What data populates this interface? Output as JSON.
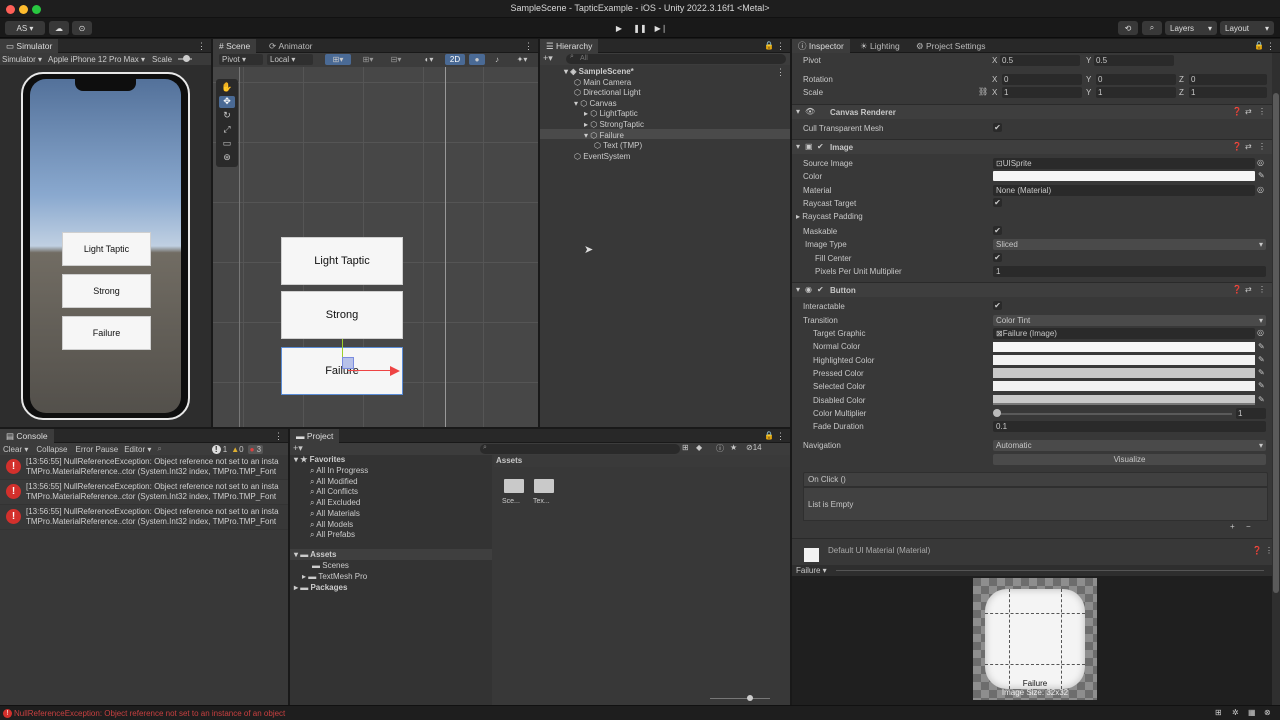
{
  "window": {
    "title": "SampleScene - TapticExample - iOS - Unity 2022.3.16f1 <Metal>"
  },
  "toolbar": {
    "account": "AS",
    "layers": "Layers",
    "layout": "Layout"
  },
  "simulator": {
    "tab": "Simulator",
    "mode": "Simulator",
    "device": "Apple iPhone 12 Pro Max",
    "scale_label": "Scale",
    "buttons": [
      "Light Taptic",
      "Strong",
      "Failure"
    ]
  },
  "scene": {
    "tabs": [
      "Scene",
      "Animator"
    ],
    "pivot": "Pivot",
    "local": "Local",
    "mode2d": "2D",
    "buttons": [
      "Light Taptic",
      "Strong",
      "Failure"
    ]
  },
  "hierarchy": {
    "tab": "Hierarchy",
    "search_placeholder": "All",
    "items": [
      {
        "label": "SampleScene*",
        "depth": 0
      },
      {
        "label": "Main Camera",
        "depth": 1
      },
      {
        "label": "Directional Light",
        "depth": 1
      },
      {
        "label": "Canvas",
        "depth": 1
      },
      {
        "label": "LightTaptic",
        "depth": 2
      },
      {
        "label": "StrongTaptic",
        "depth": 2
      },
      {
        "label": "Failure",
        "depth": 2
      },
      {
        "label": "Text (TMP)",
        "depth": 3
      },
      {
        "label": "EventSystem",
        "depth": 1
      }
    ]
  },
  "console": {
    "tab": "Console",
    "clear": "Clear",
    "collapse": "Collapse",
    "error_pause": "Error Pause",
    "editor": "Editor",
    "count_info": "1",
    "count_warn": "0",
    "count_err": "3",
    "logs": [
      {
        "line1": "[13:56:55] NullReferenceException: Object reference not set to an insta",
        "line2": "TMPro.MaterialReference..ctor (System.Int32 index, TMPro.TMP_Font"
      },
      {
        "line1": "[13:56:55] NullReferenceException: Object reference not set to an insta",
        "line2": "TMPro.MaterialReference..ctor (System.Int32 index, TMPro.TMP_Font"
      },
      {
        "line1": "[13:56:55] NullReferenceException: Object reference not set to an insta",
        "line2": "TMPro.MaterialReference..ctor (System.Int32 index, TMPro.TMP_Font"
      }
    ],
    "status": "NullReferenceException: Object reference not set to an instance of an object"
  },
  "project": {
    "tab": "Project",
    "favorites_label": "Favorites",
    "favorites": [
      "All In Progress",
      "All Modified",
      "All Conflicts",
      "All Excluded",
      "All Materials",
      "All Models",
      "All Prefabs"
    ],
    "assets_label": "Assets",
    "assets_children": [
      "Scenes",
      "TextMesh Pro"
    ],
    "packages_label": "Packages",
    "assets_header": "Assets",
    "folders": [
      "Sce...",
      "Tex..."
    ],
    "hidden_count": "14"
  },
  "inspector": {
    "tabs": [
      "Inspector",
      "Lighting",
      "Project Settings"
    ],
    "pivot": {
      "label": "Pivot",
      "x": "0.5",
      "y": "0.5"
    },
    "rotation": {
      "label": "Rotation",
      "x": "0",
      "y": "0",
      "z": "0"
    },
    "scale": {
      "label": "Scale",
      "x": "1",
      "y": "1",
      "z": "1"
    },
    "canvas_renderer": {
      "title": "Canvas Renderer",
      "cull_label": "Cull Transparent Mesh"
    },
    "image": {
      "title": "Image",
      "source_label": "Source Image",
      "source_value": "UISprite",
      "color_label": "Color",
      "material_label": "Material",
      "material_value": "None (Material)",
      "raycast_label": "Raycast Target",
      "raycast_padding_label": "Raycast Padding",
      "maskable_label": "Maskable",
      "type_label": "Image Type",
      "type_value": "Sliced",
      "fill_center_label": "Fill Center",
      "ppu_label": "Pixels Per Unit Multiplier",
      "ppu_value": "1"
    },
    "button": {
      "title": "Button",
      "interactable_label": "Interactable",
      "transition_label": "Transition",
      "transition_value": "Color Tint",
      "target_label": "Target Graphic",
      "target_value": "Failure (Image)",
      "normal_label": "Normal Color",
      "highlighted_label": "Highlighted Color",
      "pressed_label": "Pressed Color",
      "selected_label": "Selected Color",
      "disabled_label": "Disabled Color",
      "multiplier_label": "Color Multiplier",
      "multiplier_value": "1",
      "fade_label": "Fade Duration",
      "fade_value": "0.1",
      "navigation_label": "Navigation",
      "navigation_value": "Automatic",
      "visualize": "Visualize",
      "onclick_label": "On Click ()",
      "list_empty": "List is Empty"
    },
    "material_footer": "Default UI Material (Material)",
    "preview_dropdown": "Failure",
    "preview_name": "Failure",
    "preview_size": "Image Size: 32x32"
  }
}
